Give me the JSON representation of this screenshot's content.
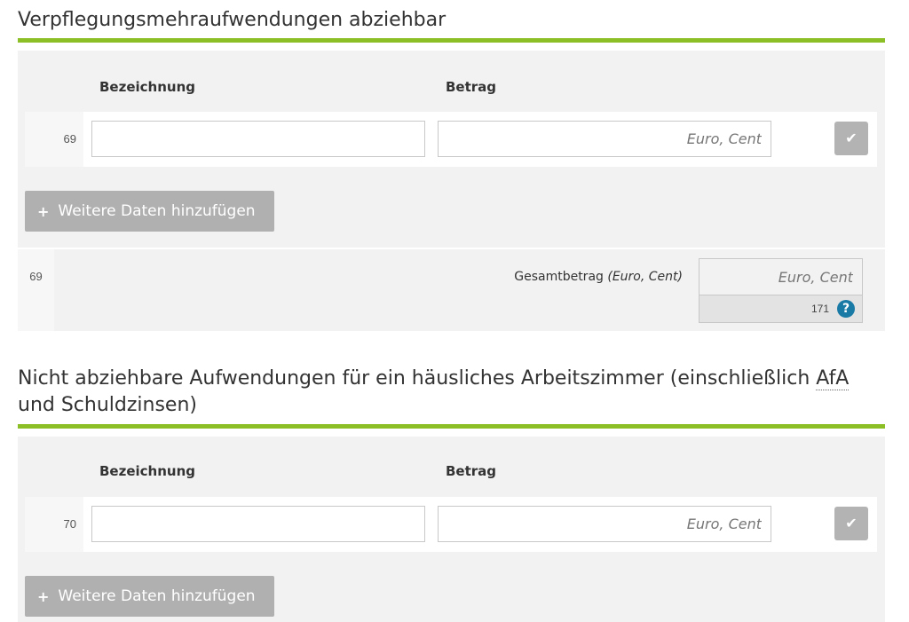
{
  "sections": [
    {
      "title": "Verpflegungsmehraufwendungen abziehbar",
      "col_headers": {
        "description": "Bezeichnung",
        "amount": "Betrag"
      },
      "row": {
        "line_number": "69",
        "description_value": "",
        "amount_value": "",
        "amount_placeholder": "Euro, Cent"
      },
      "add_button": {
        "plus": "+",
        "label": "Weitere Daten hinzufügen"
      },
      "total": {
        "line_number": "69",
        "label": "Gesamtbetrag",
        "label_unit": "(Euro, Cent)",
        "value": "",
        "placeholder": "Euro, Cent",
        "code": "171",
        "help": "?"
      }
    },
    {
      "title_part1": "Nicht abziehbare Aufwendungen für ein häusliches Arbeitszimmer (einschließlich ",
      "title_abbr": "AfA",
      "title_part2": "und Schuldzinsen)",
      "col_headers": {
        "description": "Bezeichnung",
        "amount": "Betrag"
      },
      "row": {
        "line_number": "70",
        "description_value": "",
        "amount_value": "",
        "amount_placeholder": "Euro, Cent"
      },
      "add_button": {
        "plus": "+",
        "label": "Weitere Daten hinzufügen"
      }
    }
  ],
  "colors": {
    "accent_green": "#8cbf26",
    "help_blue": "#1a7aa6",
    "button_gray": "#b0b0b0"
  },
  "icons": {
    "check": "check-icon",
    "help": "help-icon",
    "plus": "plus-icon"
  }
}
